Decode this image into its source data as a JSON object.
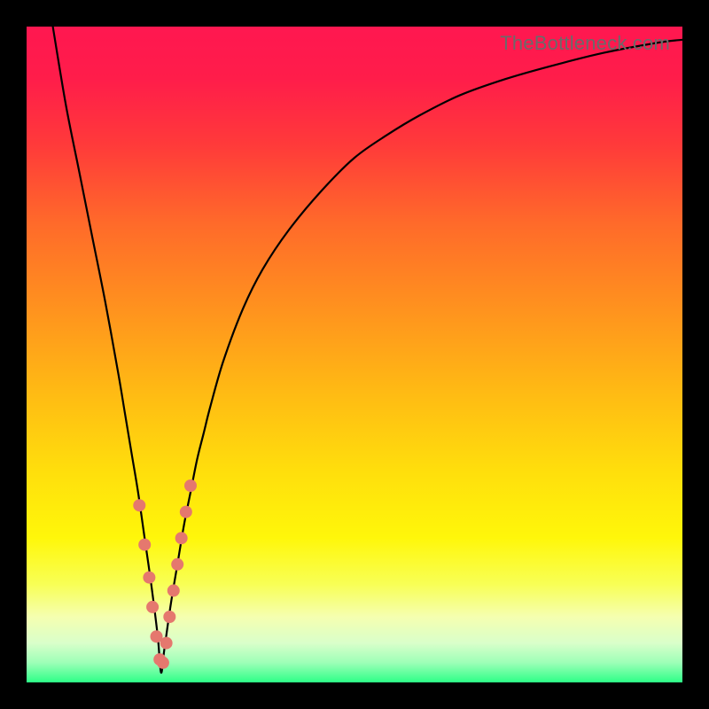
{
  "watermark": "TheBottleneck.com",
  "palette": {
    "frame": "#000000",
    "curve_stroke": "#000000",
    "marker_fill": "#e5786e",
    "marker_stroke": "#d46258",
    "gradient_stops": [
      {
        "offset": 0.0,
        "color": "#ff1750"
      },
      {
        "offset": 0.08,
        "color": "#ff1d4a"
      },
      {
        "offset": 0.18,
        "color": "#ff3a3a"
      },
      {
        "offset": 0.3,
        "color": "#ff6a2a"
      },
      {
        "offset": 0.42,
        "color": "#ff8f1f"
      },
      {
        "offset": 0.55,
        "color": "#ffb814"
      },
      {
        "offset": 0.68,
        "color": "#ffdf0c"
      },
      {
        "offset": 0.78,
        "color": "#fff70a"
      },
      {
        "offset": 0.85,
        "color": "#f8ff55"
      },
      {
        "offset": 0.9,
        "color": "#f5ffb0"
      },
      {
        "offset": 0.94,
        "color": "#d9ffca"
      },
      {
        "offset": 0.97,
        "color": "#9dffb7"
      },
      {
        "offset": 1.0,
        "color": "#2dff87"
      }
    ]
  },
  "chart_data": {
    "type": "line",
    "title": "",
    "xlabel": "",
    "ylabel": "",
    "xlim": [
      0,
      100
    ],
    "ylim": [
      0,
      100
    ],
    "grid": false,
    "x_optimum": 20.5,
    "series": [
      {
        "name": "bottleneck-curve",
        "x": [
          4,
          6,
          8,
          10,
          12,
          14,
          15,
          16,
          17,
          18,
          19,
          20,
          20.5,
          21,
          22,
          23,
          24,
          25,
          26,
          27,
          28,
          30,
          33,
          36,
          40,
          45,
          50,
          55,
          60,
          66,
          73,
          80,
          88,
          96,
          100
        ],
        "y": [
          100,
          88,
          78,
          68,
          58,
          47,
          41,
          35,
          29,
          22,
          15,
          7,
          1.5,
          5,
          12,
          18,
          24,
          29,
          34,
          38,
          42,
          49,
          57,
          63,
          69,
          75,
          80,
          83.5,
          86.5,
          89.5,
          92,
          94,
          96,
          97.5,
          98
        ]
      }
    ],
    "markers": {
      "name": "highlighted-points",
      "x": [
        17.2,
        18.0,
        18.7,
        19.2,
        19.8,
        20.3,
        20.8,
        21.3,
        21.8,
        22.4,
        23.0,
        23.6,
        24.3,
        25.0
      ],
      "y": [
        27.0,
        21.0,
        16.0,
        11.5,
        7.0,
        3.5,
        3.0,
        6.0,
        10.0,
        14.0,
        18.0,
        22.0,
        26.0,
        30.0
      ]
    }
  }
}
